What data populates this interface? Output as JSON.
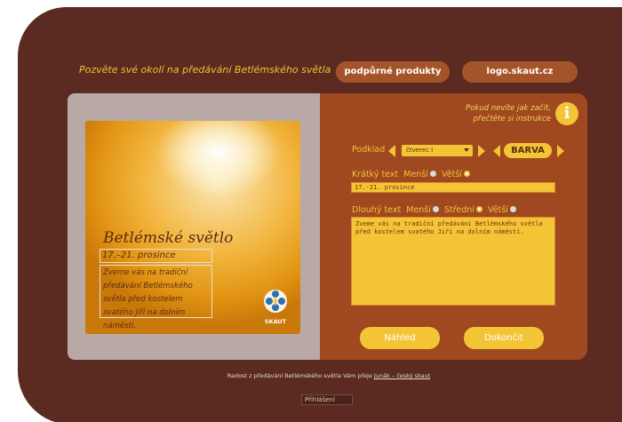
{
  "header": {
    "invite_text": "Pozvěte své okolí na předávání Betlémského světla",
    "products_button": "podpůrné produkty",
    "logo_button": "logo.skaut.cz"
  },
  "preview": {
    "title": "Betlémské světlo",
    "short_text": "17.–21. prosince",
    "long_text": "Zveme vás na tradiční předávání Betlémského světla před kostelem svatého Jiří na dolním náměstí.",
    "logo_label": "SKAUT"
  },
  "editor": {
    "help_text": "Pokud nevíte jak začít, přečtěte si instrukce",
    "info_icon": "i",
    "background_label": "Podklad",
    "background_select": "čtverec I",
    "color_button": "BARVA",
    "short_label": "Krátký text",
    "short_options": [
      "Menší",
      "Větší"
    ],
    "short_selected": "Větší",
    "short_value": "17.-21. prosince",
    "long_label": "Dlouhý text",
    "long_options": [
      "Menší",
      "Střední",
      "Větší"
    ],
    "long_selected": "Střední",
    "long_value": "Zveme vás na tradiční předávání Betlémského světla před kostelem svatého Jiří na dolním náměstí.",
    "preview_button": "Náhled",
    "finish_button": "Dokončit"
  },
  "footer": {
    "text": "Radost z předávání Betlémského světla Vám přeje ",
    "link": "Junák – český skaut",
    "login_button": "Přihlášení"
  },
  "colors": {
    "frame": "#5b2b22",
    "accent": "#f4c437",
    "panel": "#a0481f"
  }
}
